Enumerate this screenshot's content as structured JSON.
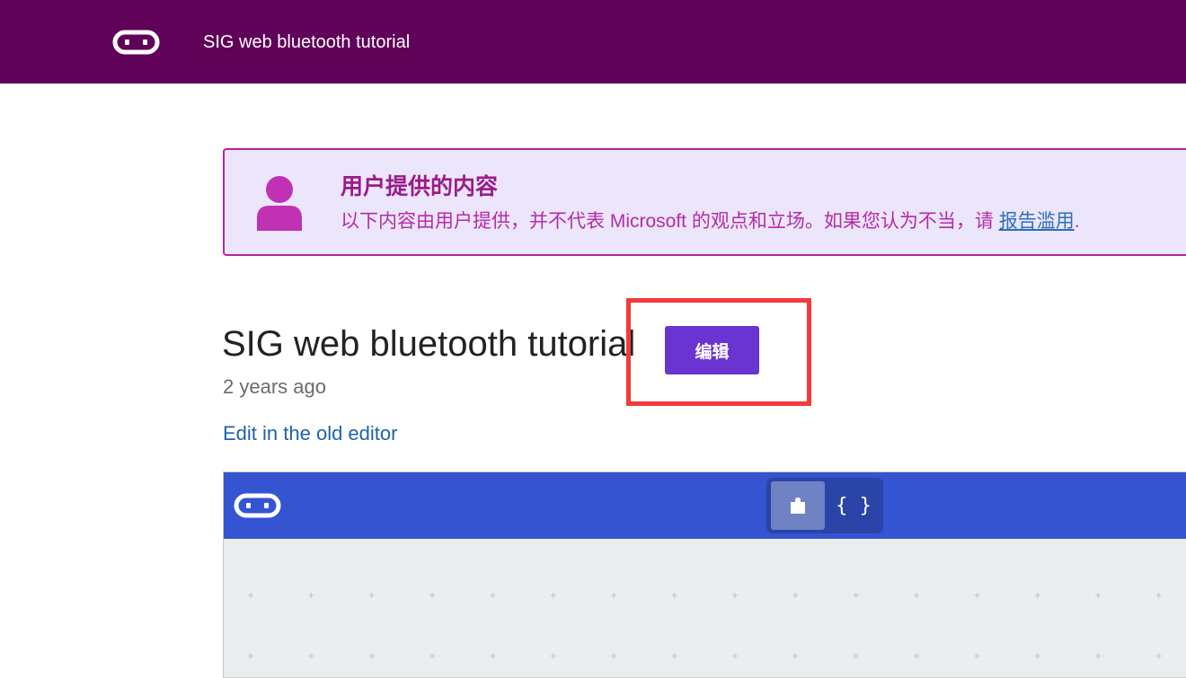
{
  "header": {
    "title": "SIG web bluetooth tutorial",
    "logo_icon": "microbit-logo-icon"
  },
  "notice": {
    "heading": "用户提供的内容",
    "body": "以下内容由用户提供，并不代表 Microsoft 的观点和立场。如果您认为不当，请",
    "link": "报告滥用",
    "tail": ".",
    "icon": "user-avatar-icon"
  },
  "project": {
    "title": "SIG web bluetooth tutorial",
    "edit_label": "编辑",
    "time": "2 years ago",
    "old_editor_link": "Edit in the old editor"
  },
  "embed": {
    "logo_icon": "microbit-logo-icon",
    "blocks_icon": "puzzle-piece-icon",
    "javascript_label": "{ }"
  },
  "colors": {
    "header_bg": "#5f0258",
    "notice_bg": "#ece6fc",
    "notice_border": "#b3259f",
    "edit_button": "#6a34d1",
    "embed_bar": "#3454d1",
    "highlight": "#f23b3b"
  }
}
